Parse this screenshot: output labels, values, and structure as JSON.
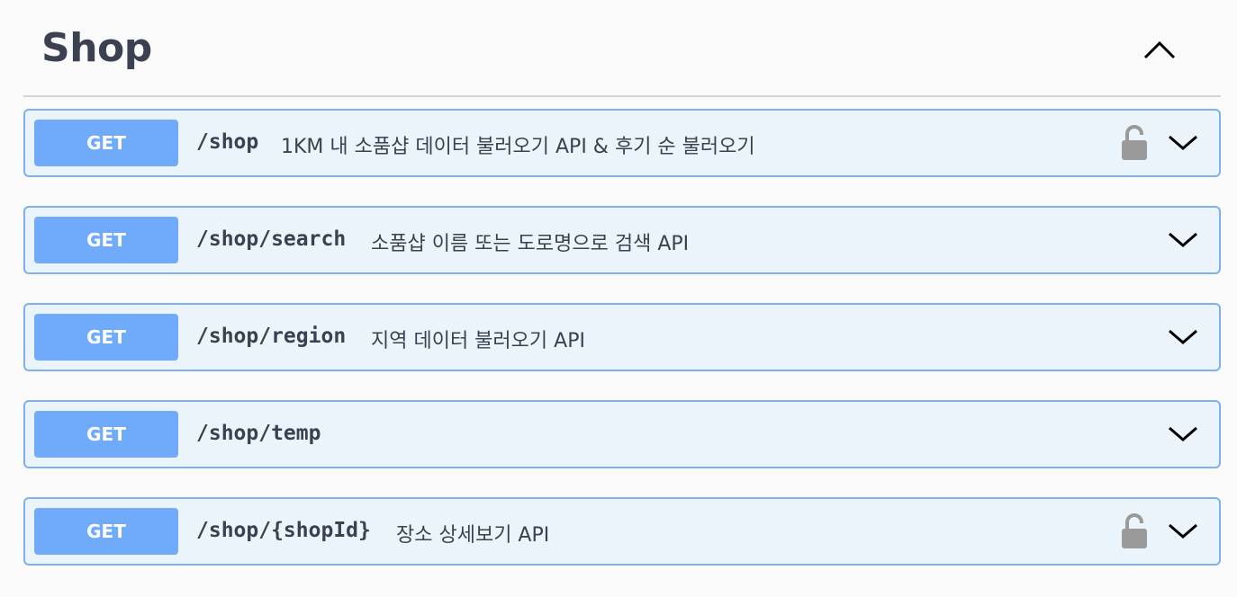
{
  "section": {
    "title": "Shop"
  },
  "operations": [
    {
      "method": "GET",
      "path": "/shop",
      "description": "1KM 내 소품샵 데이터 불러오기 API & 후기 순 불러오기",
      "locked": true
    },
    {
      "method": "GET",
      "path": "/shop/search",
      "description": "소품샵 이름 또는 도로명으로 검색 API",
      "locked": false
    },
    {
      "method": "GET",
      "path": "/shop/region",
      "description": "지역 데이터 불러오기 API",
      "locked": false
    },
    {
      "method": "GET",
      "path": "/shop/temp",
      "description": "",
      "locked": false
    },
    {
      "method": "GET",
      "path": "/shop/{shopId}",
      "description": "장소 상세보기 API",
      "locked": true
    }
  ],
  "icons": {
    "collapse": "chevron-up-icon",
    "expand": "chevron-down-icon",
    "auth": "unlocked-padlock-icon"
  },
  "colors": {
    "get_method": "#6fabfa",
    "op_background": "#ebf3fb",
    "op_border": "#7fb0ef",
    "text": "#3b4151"
  }
}
